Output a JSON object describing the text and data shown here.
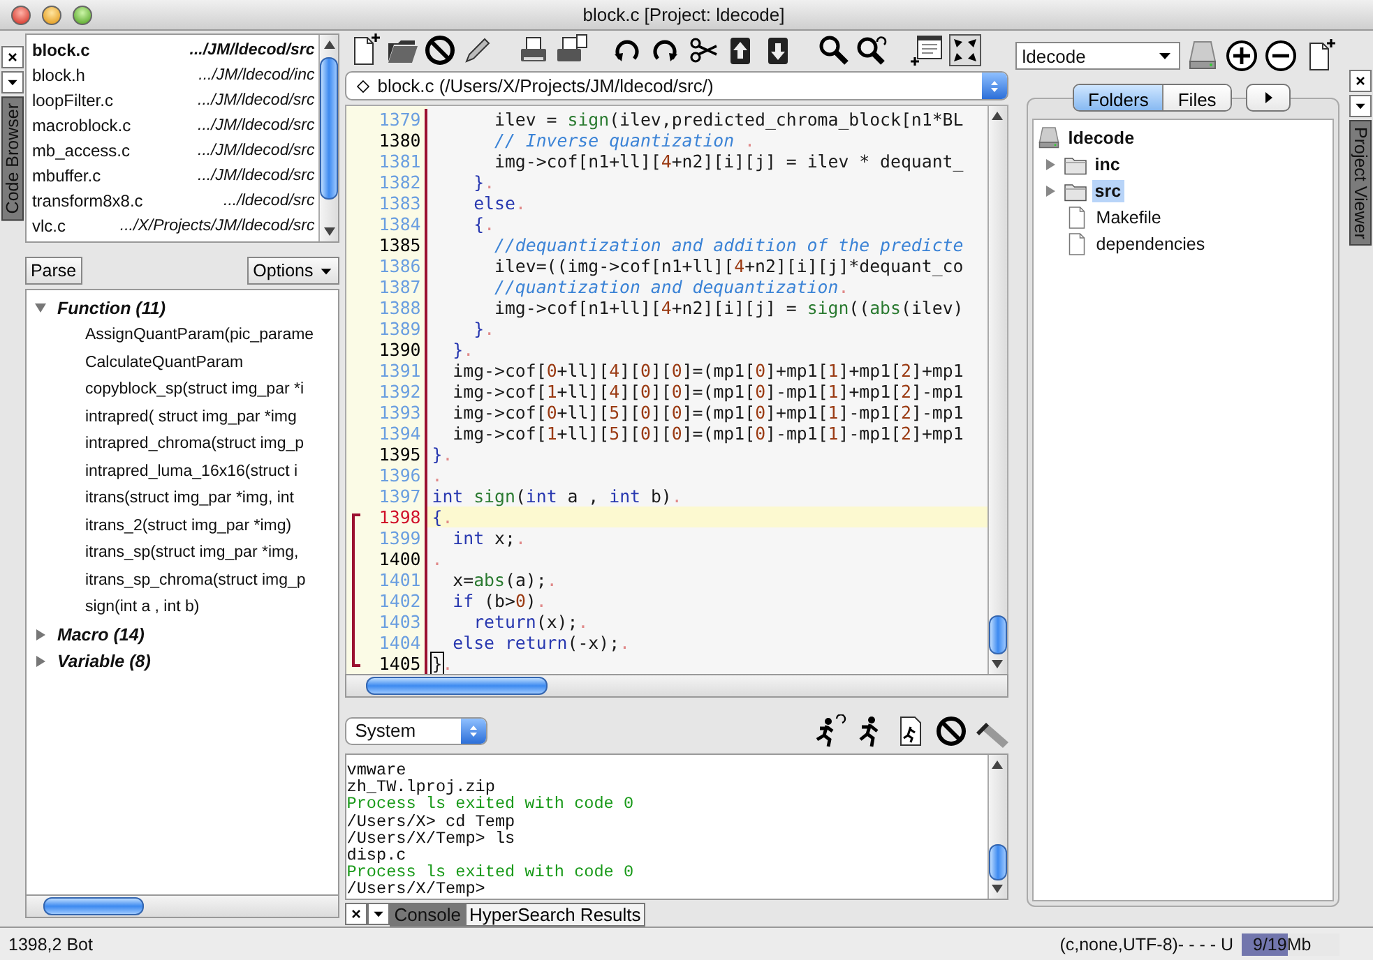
{
  "window": {
    "title": "block.c [Project: ldecode]"
  },
  "code_browser": {
    "dock_tab": "Code Browser",
    "files": [
      {
        "name": "block.c",
        "path": ".../JM/ldecod/src",
        "current": true
      },
      {
        "name": "block.h",
        "path": ".../JM/ldecod/inc",
        "current": false
      },
      {
        "name": "loopFilter.c",
        "path": ".../JM/ldecod/src",
        "current": false
      },
      {
        "name": "macroblock.c",
        "path": ".../JM/ldecod/src",
        "current": false
      },
      {
        "name": "mb_access.c",
        "path": ".../JM/ldecod/src",
        "current": false
      },
      {
        "name": "mbuffer.c",
        "path": ".../JM/ldecod/src",
        "current": false
      },
      {
        "name": "transform8x8.c",
        "path": ".../ldecod/src",
        "current": false
      },
      {
        "name": "vlc.c",
        "path": ".../X/Projects/JM/ldecod/src",
        "current": false
      }
    ],
    "parse_button": "Parse",
    "options_button": "Options",
    "tree": [
      {
        "label": "Function (11)",
        "expanded": true,
        "children": [
          {
            "label": "AssignQuantParam(pic_parame"
          },
          {
            "label": "CalculateQuantParam"
          },
          {
            "label": "copyblock_sp(struct img_par *i"
          },
          {
            "label": "intrapred( struct img_par *img"
          },
          {
            "label": "intrapred_chroma(struct img_p"
          },
          {
            "label": "intrapred_luma_16x16(struct i"
          },
          {
            "label": "itrans(struct img_par *img, int"
          },
          {
            "label": "itrans_2(struct img_par *img)"
          },
          {
            "label": "itrans_sp(struct img_par *img,"
          },
          {
            "label": "itrans_sp_chroma(struct img_p"
          },
          {
            "label": "sign(int a , int b)"
          }
        ]
      },
      {
        "label": "Macro (14)",
        "expanded": false
      },
      {
        "label": "Variable (8)",
        "expanded": false
      }
    ]
  },
  "editor": {
    "file_path": "block.c (/Users/X/Projects/JM/ldecod/src/)",
    "lines": [
      {
        "number": "1379",
        "emphasized": false,
        "current": false,
        "in_bracket": false,
        "tokens": [
          {
            "kind": "plain",
            "text": "      ilev = "
          },
          {
            "kind": "fn",
            "text": "sign"
          },
          {
            "kind": "plain",
            "text": "(ilev,predicted_chroma_block[n1*BL"
          }
        ]
      },
      {
        "number": "1380",
        "emphasized": true,
        "current": false,
        "in_bracket": false,
        "tokens": [
          {
            "kind": "comment",
            "text": "      // Inverse quantization "
          },
          {
            "kind": "eol",
            "text": "."
          }
        ]
      },
      {
        "number": "1381",
        "emphasized": false,
        "current": false,
        "in_bracket": false,
        "tokens": [
          {
            "kind": "plain",
            "text": "      img->cof[n1+ll]["
          },
          {
            "kind": "num",
            "text": "4"
          },
          {
            "kind": "plain",
            "text": "+n2][i][j] = ilev * dequant_"
          }
        ]
      },
      {
        "number": "1382",
        "emphasized": false,
        "current": false,
        "in_bracket": false,
        "tokens": [
          {
            "kind": "brace",
            "text": "    }"
          },
          {
            "kind": "eol",
            "text": "."
          }
        ]
      },
      {
        "number": "1383",
        "emphasized": false,
        "current": false,
        "in_bracket": false,
        "tokens": [
          {
            "kind": "kw",
            "text": "    else"
          },
          {
            "kind": "eol",
            "text": "."
          }
        ]
      },
      {
        "number": "1384",
        "emphasized": false,
        "current": false,
        "in_bracket": false,
        "tokens": [
          {
            "kind": "brace",
            "text": "    {"
          },
          {
            "kind": "eol",
            "text": "."
          }
        ]
      },
      {
        "number": "1385",
        "emphasized": true,
        "current": false,
        "in_bracket": false,
        "tokens": [
          {
            "kind": "comment",
            "text": "      //dequantization and addition of the predicte"
          }
        ]
      },
      {
        "number": "1386",
        "emphasized": false,
        "current": false,
        "in_bracket": false,
        "tokens": [
          {
            "kind": "plain",
            "text": "      ilev=((img->cof[n1+ll]["
          },
          {
            "kind": "num",
            "text": "4"
          },
          {
            "kind": "plain",
            "text": "+n2][i][j]*dequant_co"
          }
        ]
      },
      {
        "number": "1387",
        "emphasized": false,
        "current": false,
        "in_bracket": false,
        "tokens": [
          {
            "kind": "comment",
            "text": "      //quantization and dequantization"
          },
          {
            "kind": "eol",
            "text": "."
          }
        ]
      },
      {
        "number": "1388",
        "emphasized": false,
        "current": false,
        "in_bracket": false,
        "tokens": [
          {
            "kind": "plain",
            "text": "      img->cof[n1+ll]["
          },
          {
            "kind": "num",
            "text": "4"
          },
          {
            "kind": "plain",
            "text": "+n2][i][j] = "
          },
          {
            "kind": "fn",
            "text": "sign"
          },
          {
            "kind": "plain",
            "text": "(("
          },
          {
            "kind": "fn",
            "text": "abs"
          },
          {
            "kind": "plain",
            "text": "(ilev)"
          }
        ]
      },
      {
        "number": "1389",
        "emphasized": false,
        "current": false,
        "in_bracket": false,
        "tokens": [
          {
            "kind": "brace",
            "text": "    }"
          },
          {
            "kind": "eol",
            "text": "."
          }
        ]
      },
      {
        "number": "1390",
        "emphasized": true,
        "current": false,
        "in_bracket": false,
        "tokens": [
          {
            "kind": "brace",
            "text": "  }"
          },
          {
            "kind": "eol",
            "text": "."
          }
        ]
      },
      {
        "number": "1391",
        "emphasized": false,
        "current": false,
        "in_bracket": false,
        "tokens": [
          {
            "kind": "plain",
            "text": "  img->cof["
          },
          {
            "kind": "num",
            "text": "0"
          },
          {
            "kind": "plain",
            "text": "+ll]["
          },
          {
            "kind": "num",
            "text": "4"
          },
          {
            "kind": "plain",
            "text": "]["
          },
          {
            "kind": "num",
            "text": "0"
          },
          {
            "kind": "plain",
            "text": "]["
          },
          {
            "kind": "num",
            "text": "0"
          },
          {
            "kind": "plain",
            "text": "]=(mp1["
          },
          {
            "kind": "num",
            "text": "0"
          },
          {
            "kind": "plain",
            "text": "]+mp1["
          },
          {
            "kind": "num",
            "text": "1"
          },
          {
            "kind": "plain",
            "text": "]+mp1["
          },
          {
            "kind": "num",
            "text": "2"
          },
          {
            "kind": "plain",
            "text": "]+mp1"
          }
        ]
      },
      {
        "number": "1392",
        "emphasized": false,
        "current": false,
        "in_bracket": false,
        "tokens": [
          {
            "kind": "plain",
            "text": "  img->cof["
          },
          {
            "kind": "num",
            "text": "1"
          },
          {
            "kind": "plain",
            "text": "+ll]["
          },
          {
            "kind": "num",
            "text": "4"
          },
          {
            "kind": "plain",
            "text": "]["
          },
          {
            "kind": "num",
            "text": "0"
          },
          {
            "kind": "plain",
            "text": "]["
          },
          {
            "kind": "num",
            "text": "0"
          },
          {
            "kind": "plain",
            "text": "]=(mp1["
          },
          {
            "kind": "num",
            "text": "0"
          },
          {
            "kind": "plain",
            "text": "]-mp1["
          },
          {
            "kind": "num",
            "text": "1"
          },
          {
            "kind": "plain",
            "text": "]+mp1["
          },
          {
            "kind": "num",
            "text": "2"
          },
          {
            "kind": "plain",
            "text": "]-mp1"
          }
        ]
      },
      {
        "number": "1393",
        "emphasized": false,
        "current": false,
        "in_bracket": false,
        "tokens": [
          {
            "kind": "plain",
            "text": "  img->cof["
          },
          {
            "kind": "num",
            "text": "0"
          },
          {
            "kind": "plain",
            "text": "+ll]["
          },
          {
            "kind": "num",
            "text": "5"
          },
          {
            "kind": "plain",
            "text": "]["
          },
          {
            "kind": "num",
            "text": "0"
          },
          {
            "kind": "plain",
            "text": "]["
          },
          {
            "kind": "num",
            "text": "0"
          },
          {
            "kind": "plain",
            "text": "]=(mp1["
          },
          {
            "kind": "num",
            "text": "0"
          },
          {
            "kind": "plain",
            "text": "]+mp1["
          },
          {
            "kind": "num",
            "text": "1"
          },
          {
            "kind": "plain",
            "text": "]-mp1["
          },
          {
            "kind": "num",
            "text": "2"
          },
          {
            "kind": "plain",
            "text": "]-mp1"
          }
        ]
      },
      {
        "number": "1394",
        "emphasized": false,
        "current": false,
        "in_bracket": false,
        "tokens": [
          {
            "kind": "plain",
            "text": "  img->cof["
          },
          {
            "kind": "num",
            "text": "1"
          },
          {
            "kind": "plain",
            "text": "+ll]["
          },
          {
            "kind": "num",
            "text": "5"
          },
          {
            "kind": "plain",
            "text": "]["
          },
          {
            "kind": "num",
            "text": "0"
          },
          {
            "kind": "plain",
            "text": "]["
          },
          {
            "kind": "num",
            "text": "0"
          },
          {
            "kind": "plain",
            "text": "]=(mp1["
          },
          {
            "kind": "num",
            "text": "0"
          },
          {
            "kind": "plain",
            "text": "]-mp1["
          },
          {
            "kind": "num",
            "text": "1"
          },
          {
            "kind": "plain",
            "text": "]-mp1["
          },
          {
            "kind": "num",
            "text": "2"
          },
          {
            "kind": "plain",
            "text": "]+mp1"
          }
        ]
      },
      {
        "number": "1395",
        "emphasized": true,
        "current": false,
        "in_bracket": false,
        "tokens": [
          {
            "kind": "brace",
            "text": "}"
          },
          {
            "kind": "eol",
            "text": "."
          }
        ]
      },
      {
        "number": "1396",
        "emphasized": false,
        "current": false,
        "in_bracket": false,
        "tokens": [
          {
            "kind": "eol",
            "text": "."
          }
        ]
      },
      {
        "number": "1397",
        "emphasized": false,
        "current": false,
        "in_bracket": false,
        "tokens": [
          {
            "kind": "kw",
            "text": "int "
          },
          {
            "kind": "fn",
            "text": "sign"
          },
          {
            "kind": "plain",
            "text": "("
          },
          {
            "kind": "kw",
            "text": "int"
          },
          {
            "kind": "plain",
            "text": " a , "
          },
          {
            "kind": "kw",
            "text": "int"
          },
          {
            "kind": "plain",
            "text": " b)"
          },
          {
            "kind": "eol",
            "text": "."
          }
        ]
      },
      {
        "number": "1398",
        "emphasized": false,
        "current": true,
        "in_bracket": true,
        "tokens": [
          {
            "kind": "brace",
            "text": "{"
          },
          {
            "kind": "eol",
            "text": "."
          }
        ]
      },
      {
        "number": "1399",
        "emphasized": false,
        "current": false,
        "in_bracket": true,
        "tokens": [
          {
            "kind": "kw",
            "text": "  int"
          },
          {
            "kind": "plain",
            "text": " x;"
          },
          {
            "kind": "eol",
            "text": "."
          }
        ]
      },
      {
        "number": "1400",
        "emphasized": true,
        "current": false,
        "in_bracket": true,
        "tokens": [
          {
            "kind": "eol",
            "text": "."
          }
        ]
      },
      {
        "number": "1401",
        "emphasized": false,
        "current": false,
        "in_bracket": true,
        "tokens": [
          {
            "kind": "plain",
            "text": "  x="
          },
          {
            "kind": "fn",
            "text": "abs"
          },
          {
            "kind": "plain",
            "text": "(a);"
          },
          {
            "kind": "eol",
            "text": "."
          }
        ]
      },
      {
        "number": "1402",
        "emphasized": false,
        "current": false,
        "in_bracket": true,
        "tokens": [
          {
            "kind": "kw",
            "text": "  if"
          },
          {
            "kind": "plain",
            "text": " (b>"
          },
          {
            "kind": "num",
            "text": "0"
          },
          {
            "kind": "plain",
            "text": ")"
          },
          {
            "kind": "eol",
            "text": "."
          }
        ]
      },
      {
        "number": "1403",
        "emphasized": false,
        "current": false,
        "in_bracket": true,
        "tokens": [
          {
            "kind": "kw",
            "text": "    return"
          },
          {
            "kind": "plain",
            "text": "(x);"
          },
          {
            "kind": "eol",
            "text": "."
          }
        ]
      },
      {
        "number": "1404",
        "emphasized": false,
        "current": false,
        "in_bracket": true,
        "tokens": [
          {
            "kind": "kw",
            "text": "  else return"
          },
          {
            "kind": "plain",
            "text": "(-x);"
          },
          {
            "kind": "eol",
            "text": "."
          }
        ]
      },
      {
        "number": "1405",
        "emphasized": true,
        "current": false,
        "in_bracket": true,
        "tokens": [
          {
            "kind": "caret",
            "text": "}"
          },
          {
            "kind": "eol",
            "text": "."
          }
        ]
      }
    ]
  },
  "console": {
    "shell": "System",
    "output": [
      {
        "text": "vmware",
        "kind": "plain"
      },
      {
        "text": "zh_TW.lproj.zip",
        "kind": "plain"
      },
      {
        "text": "Process ls exited with code 0",
        "kind": "status"
      },
      {
        "text": "/Users/X> cd Temp",
        "kind": "plain"
      },
      {
        "text": "/Users/X/Temp> ls",
        "kind": "plain"
      },
      {
        "text": "disp.c",
        "kind": "plain"
      },
      {
        "text": "Process ls exited with code 0",
        "kind": "status"
      },
      {
        "text": "/Users/X/Temp>",
        "kind": "plain"
      }
    ],
    "tabs": [
      {
        "label": "Console",
        "selected": true
      },
      {
        "label": "HyperSearch Results",
        "selected": false
      }
    ]
  },
  "project_viewer": {
    "dock_tab": "Project Viewer",
    "project": "ldecode",
    "tabs": [
      {
        "label": "Folders",
        "selected": true
      },
      {
        "label": "Files",
        "selected": false
      }
    ],
    "tree": [
      {
        "label": "ldecode",
        "kind": "project",
        "selected": false,
        "children": [
          {
            "label": "inc",
            "kind": "folder",
            "expanded": false,
            "selected": false
          },
          {
            "label": "src",
            "kind": "folder",
            "expanded": false,
            "selected": true
          },
          {
            "label": "Makefile",
            "kind": "file",
            "selected": false
          },
          {
            "label": "dependencies",
            "kind": "file",
            "selected": false
          }
        ]
      }
    ]
  },
  "status_bar": {
    "position": "1398,2 Bot",
    "mode": "(c,none,UTF-8)- - - - U",
    "memory": {
      "text": "9/19Mb",
      "level": 0.47
    }
  }
}
